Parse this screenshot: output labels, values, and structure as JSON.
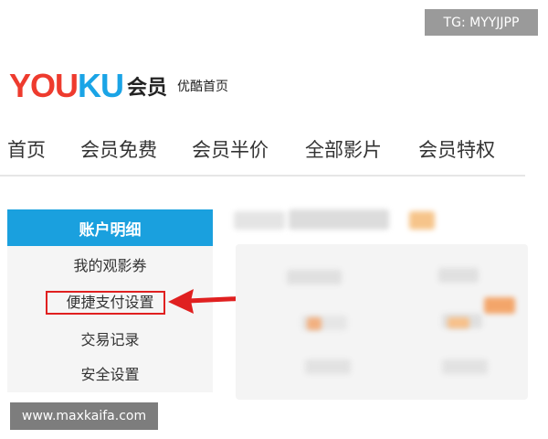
{
  "watermark_top": "TG: MYYJJPP",
  "header": {
    "logo_part1": "YOU",
    "logo_part2": "KU",
    "logo_suffix": "会员",
    "home_link": "优酷首页"
  },
  "nav": {
    "items": [
      "首页",
      "会员免费",
      "会员半价",
      "全部影片",
      "会员特权"
    ]
  },
  "sidebar": {
    "active_label": "账户明细",
    "items": [
      "我的观影券",
      "便捷支付设置",
      "交易记录",
      "安全设置"
    ]
  },
  "colors": {
    "brand_red": "#ee3b2e",
    "brand_blue": "#1aa4e6",
    "active_bg": "#1aa0de",
    "annotation_red": "#e02020"
  },
  "watermark_bottom": "www.maxkaifa.com"
}
